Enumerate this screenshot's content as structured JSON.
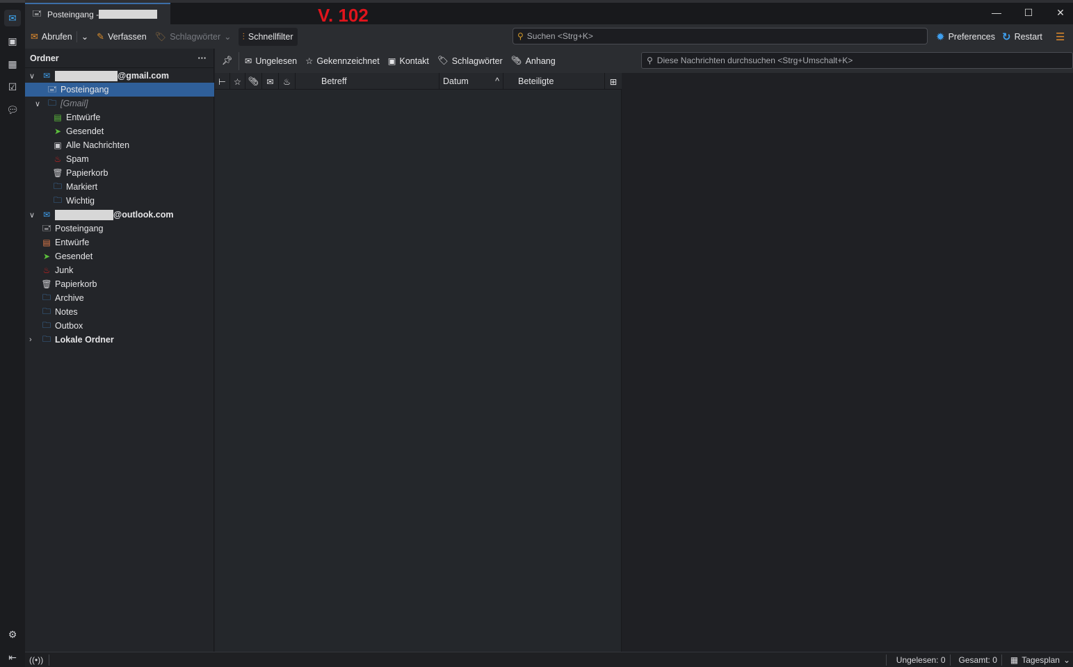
{
  "window": {
    "tab_title": "Posteingang - ",
    "version_label": "V. 102"
  },
  "spaces": [
    "mail-icon",
    "address-book-icon",
    "calendar-icon",
    "tasks-icon",
    "chat-icon"
  ],
  "toolbar": {
    "get_messages": "Abrufen",
    "write": "Verfassen",
    "tags": "Schlagwörter",
    "quick_filter": "Schnellfilter",
    "search_placeholder": "Suchen <Strg+K>",
    "preferences": "Preferences",
    "restart": "Restart"
  },
  "folder_pane": {
    "title": "Ordner",
    "more": "···"
  },
  "folders": [
    {
      "label": "@gmail.com",
      "type": "account",
      "level": 0,
      "expanded": true,
      "redacted": true
    },
    {
      "label": "Posteingang",
      "type": "inbox",
      "level": 1,
      "selected": true
    },
    {
      "label": "[Gmail]",
      "type": "folder",
      "level": 1,
      "expanded": true,
      "italic": true
    },
    {
      "label": "Entwürfe",
      "type": "drafts",
      "level": 2
    },
    {
      "label": "Gesendet",
      "type": "sent",
      "level": 2
    },
    {
      "label": "Alle Nachrichten",
      "type": "archive",
      "level": 2
    },
    {
      "label": "Spam",
      "type": "junk",
      "level": 2
    },
    {
      "label": "Papierkorb",
      "type": "trash",
      "level": 2
    },
    {
      "label": "Markiert",
      "type": "folder",
      "level": 2
    },
    {
      "label": "Wichtig",
      "type": "folder",
      "level": 2
    },
    {
      "label": "@outlook.com",
      "type": "account",
      "level": 0,
      "expanded": true,
      "redacted": true
    },
    {
      "label": "Posteingang",
      "type": "inbox",
      "level": 1
    },
    {
      "label": "Entwürfe",
      "type": "drafts2",
      "level": 1
    },
    {
      "label": "Gesendet",
      "type": "sent",
      "level": 1
    },
    {
      "label": "Junk",
      "type": "junk",
      "level": 1
    },
    {
      "label": "Papierkorb",
      "type": "trash",
      "level": 1
    },
    {
      "label": "Archive",
      "type": "folder",
      "level": 1
    },
    {
      "label": "Notes",
      "type": "folder",
      "level": 1
    },
    {
      "label": "Outbox",
      "type": "folder",
      "level": 1
    },
    {
      "label": "Lokale Ordner",
      "type": "local",
      "level": 0,
      "expanded": false
    }
  ],
  "quick_filter": {
    "unread": "Ungelesen",
    "starred": "Gekennzeichnet",
    "contact": "Kontakt",
    "tags": "Schlagwörter",
    "attachment": "Anhang",
    "search_placeholder": "Diese Nachrichten durchsuchen <Strg+Umschalt+K>"
  },
  "columns": {
    "subject": "Betreff",
    "date": "Datum",
    "correspondents": "Beteiligte"
  },
  "status": {
    "unread": "Ungelesen: 0",
    "total": "Gesamt: 0",
    "today": "Tagesplan"
  }
}
